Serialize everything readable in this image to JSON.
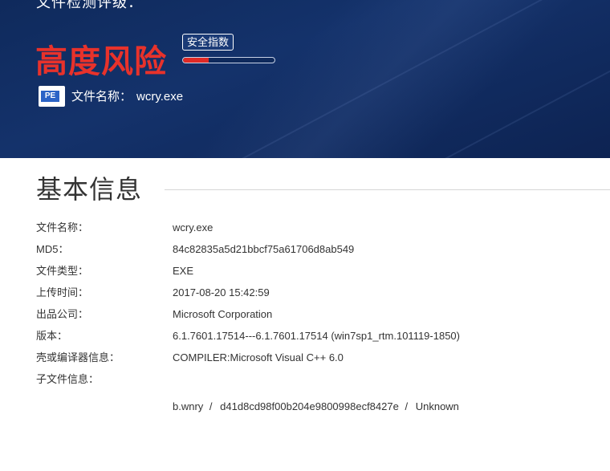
{
  "banner": {
    "partial_heading": "文件检测评级：",
    "risk_level": "高度风险",
    "safety_tag": "安全指数",
    "safety_index": 0.28,
    "file_icon_label": "PE",
    "filename_label": "文件名称：",
    "filename_value": "wcry.exe"
  },
  "section": {
    "title": "基本信息"
  },
  "info": [
    {
      "key": "文件名称：",
      "value": "wcry.exe"
    },
    {
      "key": "MD5：",
      "value": "84c82835a5d21bbcf75a61706d8ab549"
    },
    {
      "key": "文件类型：",
      "value": "EXE"
    },
    {
      "key": "上传时间：",
      "value": "2017-08-20 15:42:59"
    },
    {
      "key": "出品公司：",
      "value": "Microsoft Corporation"
    },
    {
      "key": "版本：",
      "value": "6.1.7601.17514---6.1.7601.17514 (win7sp1_rtm.101119-1850)"
    },
    {
      "key": "壳或编译器信息：",
      "value": "COMPILER:Microsoft Visual C++ 6.0"
    },
    {
      "key": "子文件信息：",
      "value": ""
    }
  ],
  "subfiles": [
    {
      "name": "b.wnry",
      "sep1": "/",
      "hash": "d41d8cd98f00b204e9800998ecf8427e",
      "sep2": "/",
      "status": "Unknown"
    }
  ],
  "colors": {
    "banner_bg": "#14326b",
    "risk_red": "#e8322b"
  }
}
